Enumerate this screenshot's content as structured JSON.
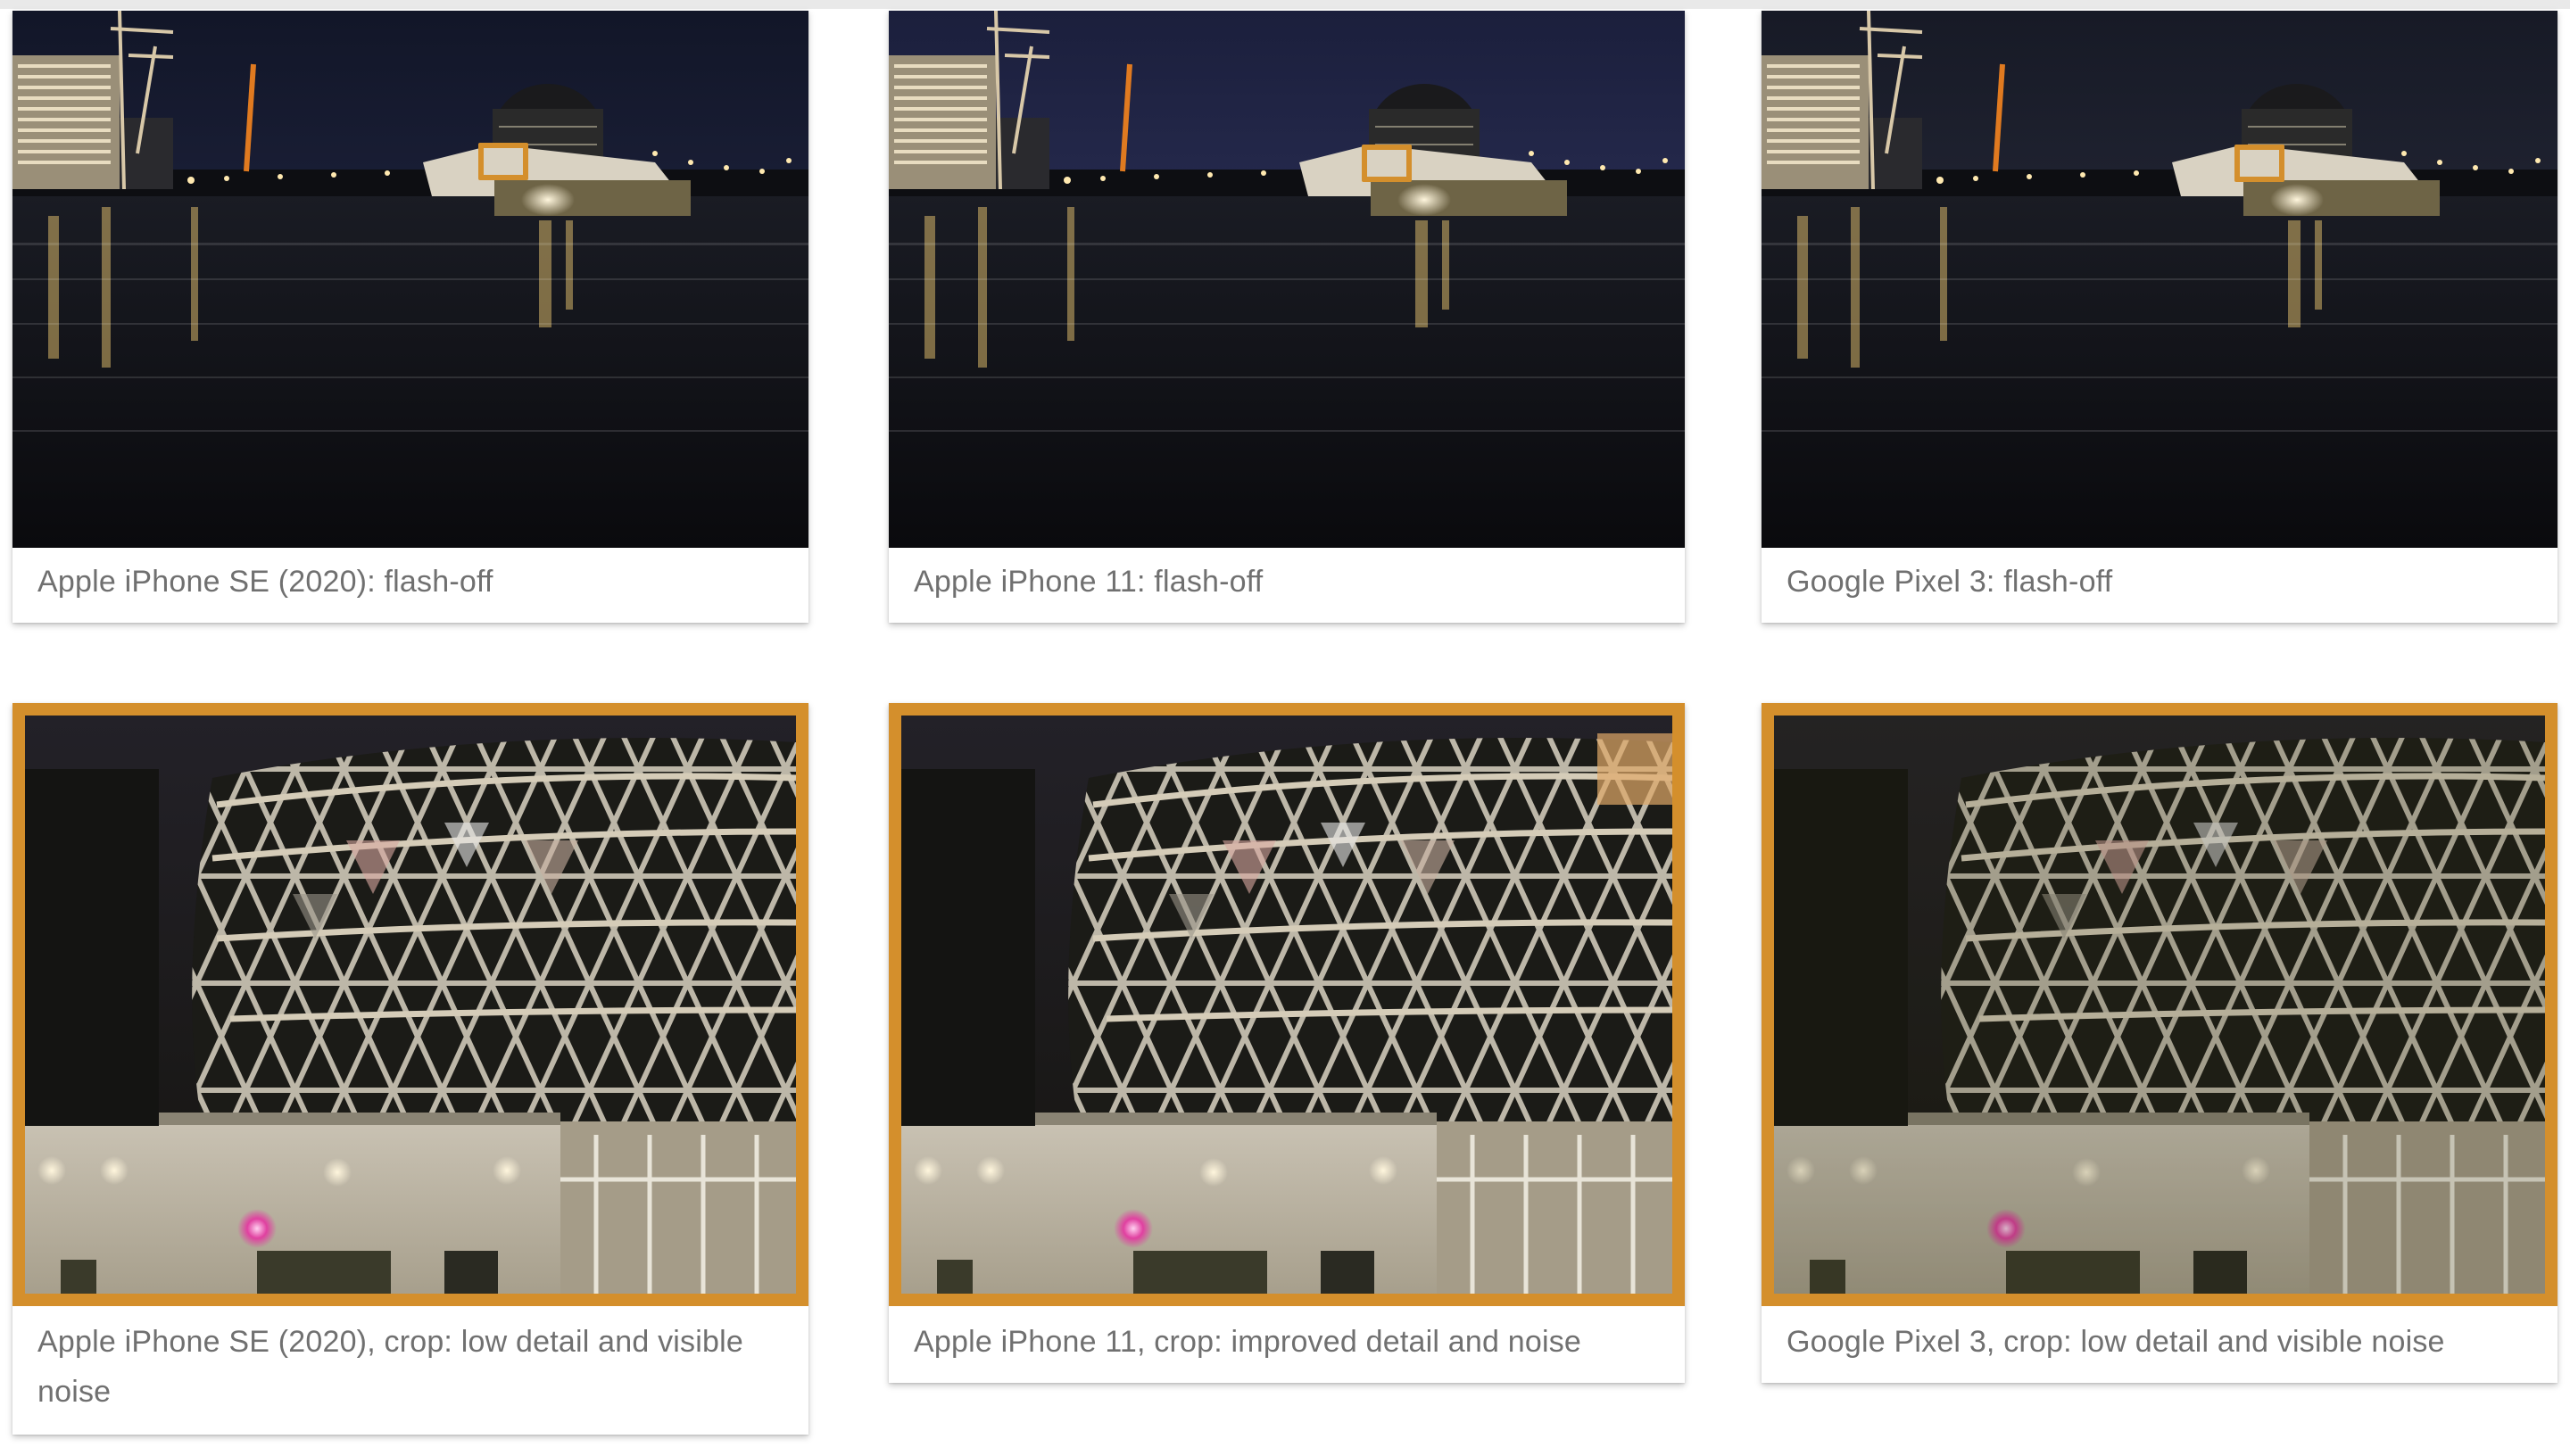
{
  "colors": {
    "frame_orange": "#d48f2c",
    "caption_text": "#707070",
    "card_bg": "#ffffff"
  },
  "row1": [
    {
      "caption": "Apple iPhone SE (2020): flash-off",
      "image": "night river scene with lit dome building"
    },
    {
      "caption": "Apple iPhone 11: flash-off",
      "image": "night river scene with lit dome building"
    },
    {
      "caption": "Google Pixel 3: flash-off",
      "image": "night river scene with lit dome building"
    }
  ],
  "row2": [
    {
      "caption": "Apple iPhone SE (2020), crop: low detail and visible noise",
      "image": "crop of glass dome lattice"
    },
    {
      "caption": "Apple iPhone 11, crop: improved detail and noise",
      "image": "crop of glass dome lattice"
    },
    {
      "caption": "Google Pixel 3, crop: low detail and visible noise",
      "image": "crop of glass dome lattice"
    }
  ]
}
